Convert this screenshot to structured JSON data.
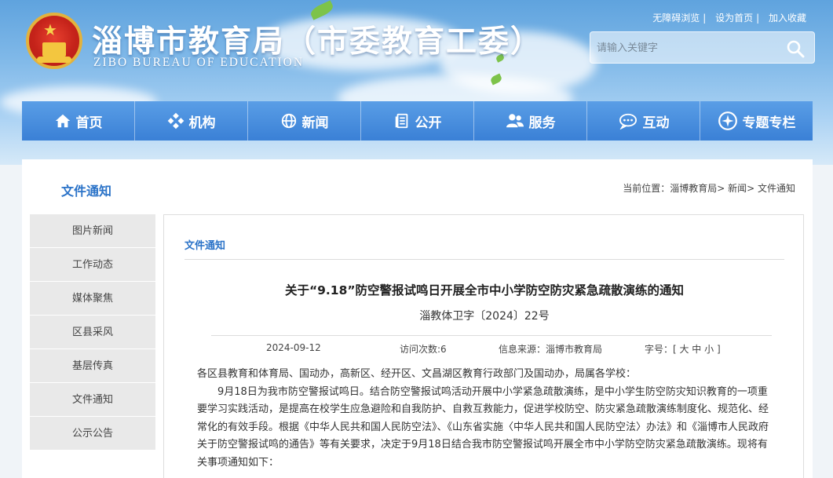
{
  "header": {
    "title": "淄博市教育局（市委教育工委）",
    "subtitle": "ZIBO BUREAU OF EDUCATION",
    "top_links": [
      "无障碍浏览",
      "设为首页",
      "加入收藏"
    ],
    "search_placeholder": "请输入关键字"
  },
  "nav": {
    "items": [
      {
        "label": "首页",
        "icon": "home-icon"
      },
      {
        "label": "机构",
        "icon": "org-icon"
      },
      {
        "label": "新闻",
        "icon": "globe-icon"
      },
      {
        "label": "公开",
        "icon": "document-icon"
      },
      {
        "label": "服务",
        "icon": "users-icon"
      },
      {
        "label": "互动",
        "icon": "chat-icon"
      },
      {
        "label": "专题专栏",
        "icon": "compass-icon"
      }
    ]
  },
  "section_title": "文件通知",
  "breadcrumb": {
    "prefix": "当前位置：",
    "path": "淄博教育局> 新闻> 文件通知"
  },
  "sidebar": {
    "items": [
      "图片新闻",
      "工作动态",
      "媒体聚焦",
      "区县采风",
      "基层传真",
      "文件通知",
      "公示公告"
    ]
  },
  "article": {
    "category": "文件通知",
    "title": "关于“9.18”防空警报试鸣日开展全市中小学防空防灾紧急疏散演练的通知",
    "doc_no": "淄教体卫字〔2024〕22号",
    "date": "2024-09-12",
    "views": "访问次数:6",
    "source": "信息来源：淄博市教育局",
    "font_size_label": "字号：[ 大 中 小 ]",
    "paragraphs": [
      "各区县教育和体育局、国动办，高新区、经开区、文昌湖区教育行政部门及国动办，局属各学校：",
      "　　9月18日为我市防空警报试鸣日。结合防空警报试鸣活动开展中小学紧急疏散演练，是中小学生防空防灾知识教育的一项重要学习实践活动，是提高在校学生应急避险和自我防护、自救互救能力，促进学校防空、防灾紧急疏散演练制度化、规范化、经常化的有效手段。根据《中华人民共和国人民防空法》、《山东省实施〈中华人民共和国人民防空法〉办法》和《淄博市人民政府关于防空警报试鸣的通告》等有关要求，决定于9月18日结合我市防空警报试鸣开展全市中小学防空防灾紧急疏散演练。现将有关事项通知如下："
    ]
  }
}
